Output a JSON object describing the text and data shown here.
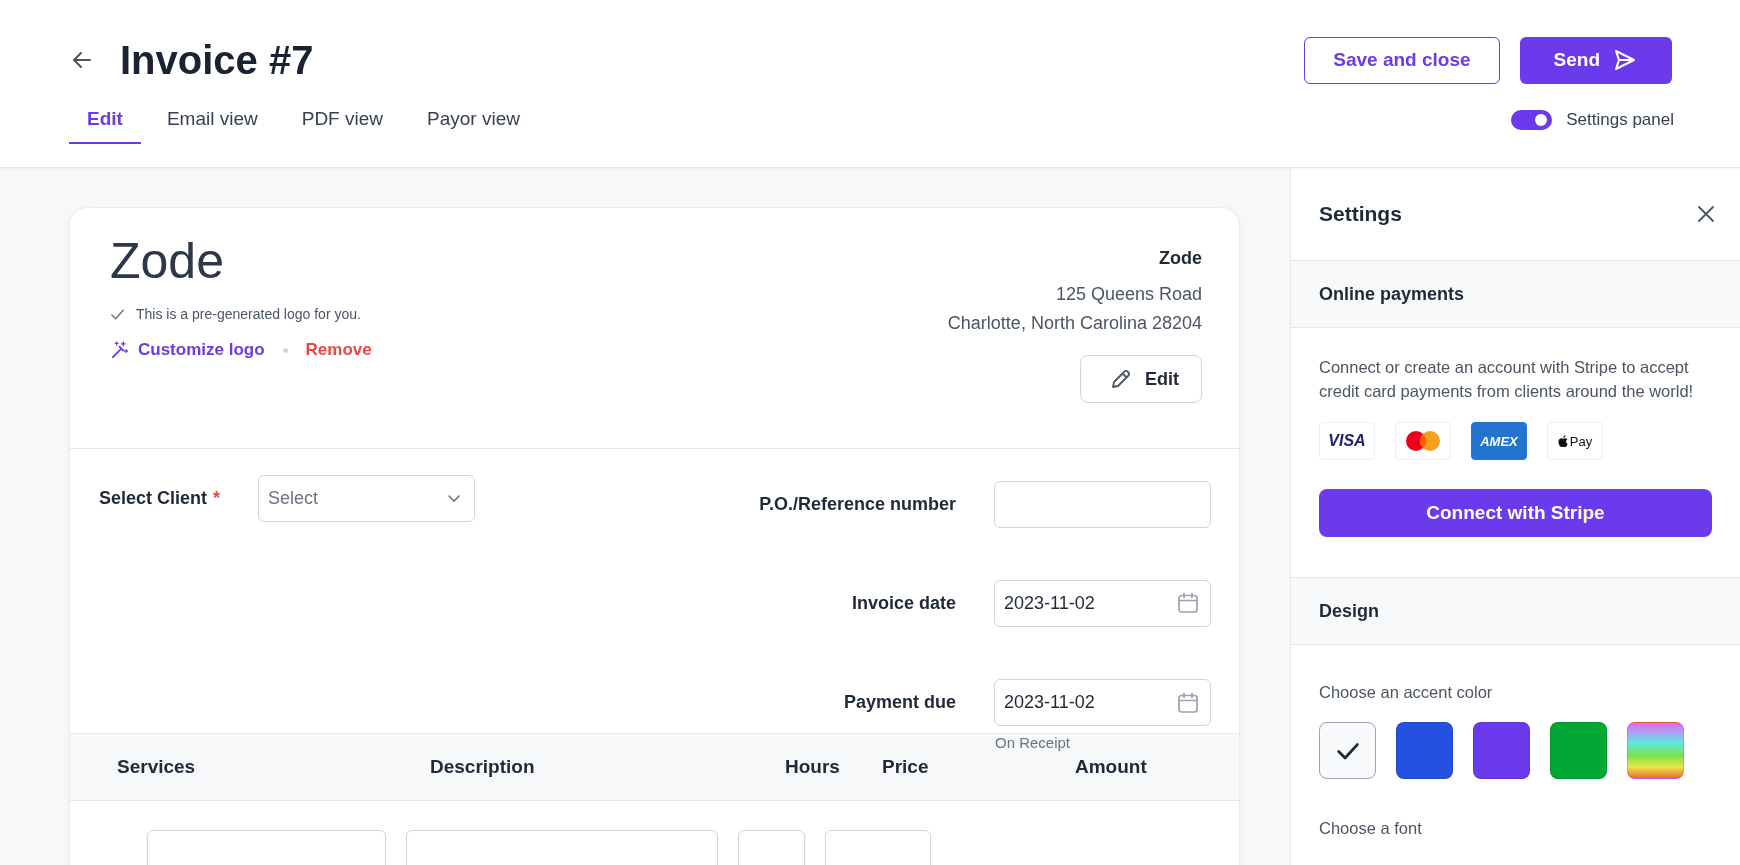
{
  "page": {
    "title": "Invoice #7"
  },
  "header_buttons": [
    {
      "label": "Save and close",
      "kind": "outline"
    },
    {
      "label": "Send",
      "kind": "primary"
    }
  ],
  "tabs": [
    {
      "label": "Edit",
      "selected": true
    },
    {
      "label": "Email view",
      "selected": false
    },
    {
      "label": "PDF view",
      "selected": false
    },
    {
      "label": "Payor view",
      "selected": false
    }
  ],
  "settings_toggle": {
    "label": "Settings panel",
    "on": true
  },
  "invoice": {
    "logo_text": "Zode",
    "logo_note": "This is a pre-generated logo for you.",
    "logo_actions": [
      {
        "label": "Customize logo",
        "kind": "customize"
      },
      {
        "label": "Remove",
        "kind": "remove"
      }
    ],
    "business": {
      "name": "Zode",
      "address_lines": [
        "125 Queens Road",
        "Charlotte, North Carolina 28204"
      ],
      "edit_button": "Edit"
    },
    "client": {
      "label": "Select Client",
      "required_mark": "*",
      "placeholder": "Select"
    },
    "fields": [
      {
        "label": "P.O./Reference number",
        "kind": "text"
      },
      {
        "label": "Invoice date",
        "value": "2023-11-02",
        "kind": "date"
      },
      {
        "label": "Payment due",
        "value": "2023-11-02",
        "kind": "date",
        "note": "On Receipt"
      }
    ],
    "table": {
      "columns": [
        "Services",
        "Description",
        "Hours",
        "Price",
        "Amount"
      ]
    }
  },
  "settings": {
    "title": "Settings",
    "online_payments": {
      "heading": "Online payments",
      "description": "Connect or create an account with Stripe to accept credit card payments from clients around the world!",
      "methods": [
        {
          "kind": "visa",
          "label": "VISA"
        },
        {
          "kind": "mastercard"
        },
        {
          "kind": "amex",
          "label": "AMEX"
        },
        {
          "kind": "applepay",
          "label": "Pay"
        }
      ],
      "button": "Connect with Stripe"
    },
    "design": {
      "heading": "Design",
      "accent_label": "Choose an accent color",
      "accents": [
        {
          "kind": "solid",
          "color": "#f8fafc",
          "selected": true
        },
        {
          "kind": "solid",
          "color": "#2352e3",
          "selected": false
        },
        {
          "kind": "solid",
          "color": "#6b3aed",
          "selected": false
        },
        {
          "kind": "solid",
          "color": "#02a834",
          "selected": false
        },
        {
          "kind": "gradient",
          "selected": false
        }
      ],
      "font_label": "Choose a font"
    }
  }
}
